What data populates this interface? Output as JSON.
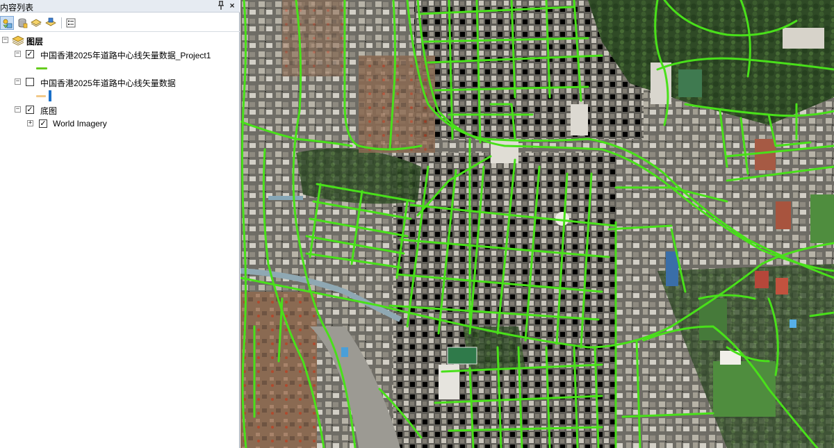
{
  "toc": {
    "title": "内容列表",
    "pin_glyph": "ᵠ",
    "close_glyph": "×",
    "toolbar": [
      {
        "name": "list-by-drawing-order-button",
        "icon": "list-drawing-order-icon"
      },
      {
        "name": "list-by-source-button",
        "icon": "list-by-source-icon"
      },
      {
        "name": "list-by-visibility-button",
        "icon": "list-by-visibility-icon"
      },
      {
        "name": "list-by-selection-button",
        "icon": "list-by-selection-icon"
      },
      {
        "name": "options-button",
        "icon": "options-icon"
      }
    ],
    "layers_group": {
      "label": "图层",
      "expander": "−",
      "items": [
        {
          "label": "中国香港2025年道路中心线矢量数据_Project1",
          "checked": true,
          "checkbox_glyph": "✓",
          "expander": "−",
          "symbol_color": "#66cc1e"
        },
        {
          "label": "中国香港2025年道路中心线矢量数据",
          "checked": false,
          "checkbox_glyph": "",
          "expander": "−",
          "symbol_color": "#f2c98a",
          "symbol_accent": "#1a6fc8"
        }
      ]
    },
    "basemap_group": {
      "label": "底图",
      "checked": true,
      "checkbox_glyph": "✓",
      "expander": "−",
      "items": [
        {
          "label": "World Imagery",
          "checked": true,
          "checkbox_glyph": "✓",
          "expander": "+"
        }
      ]
    }
  },
  "map": {
    "road_color": "#49e01a",
    "imagery": "World Imagery satellite view of Hong Kong urban area"
  }
}
